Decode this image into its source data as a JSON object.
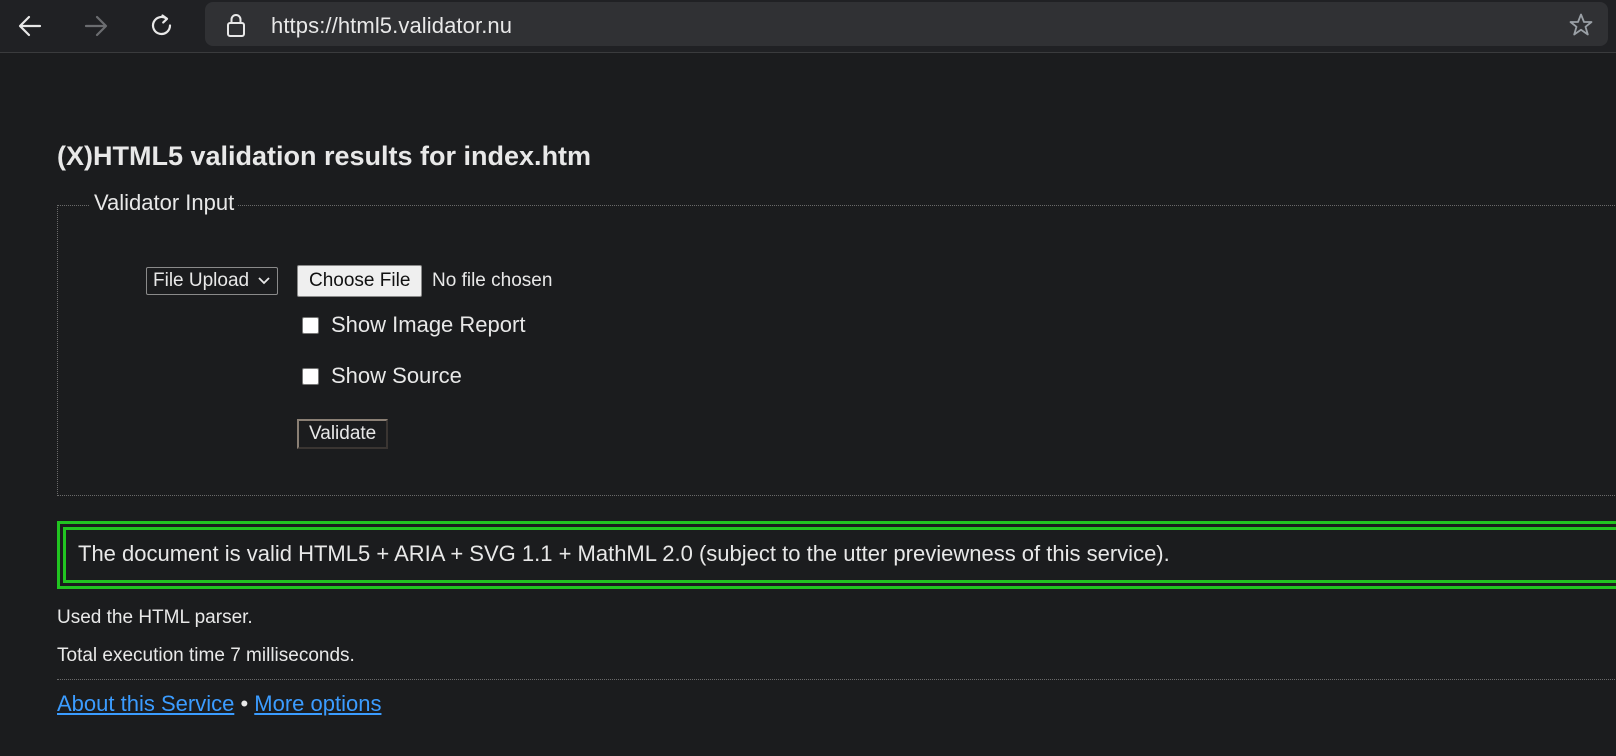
{
  "browser": {
    "url_scheme": "https://",
    "url_host": "html5.validator.nu",
    "icons": [
      "back-icon",
      "forward-icon",
      "reload-icon",
      "lock-icon",
      "star-icon"
    ]
  },
  "page": {
    "title": "(X)HTML5 validation results for index.htm",
    "form": {
      "legend": "Validator Input",
      "input_mode": "File Upload",
      "choose_file_label": "Choose File",
      "file_status": "No file chosen",
      "show_image_report": "Show Image Report",
      "show_source": "Show Source",
      "validate_label": "Validate"
    },
    "result_message": "The document is valid HTML5 + ARIA + SVG 1.1 + MathML 2.0 (subject to the utter previewness of this service).",
    "parser_info": "Used the HTML parser.",
    "execution_time": "Total execution time 7 milliseconds.",
    "footer": {
      "about_link": "About this Service",
      "separator": "•",
      "options_link": "More options"
    }
  },
  "colors": {
    "page_bg": "#1b1c1e",
    "success_border": "#21c421",
    "link": "#3b9cff"
  }
}
